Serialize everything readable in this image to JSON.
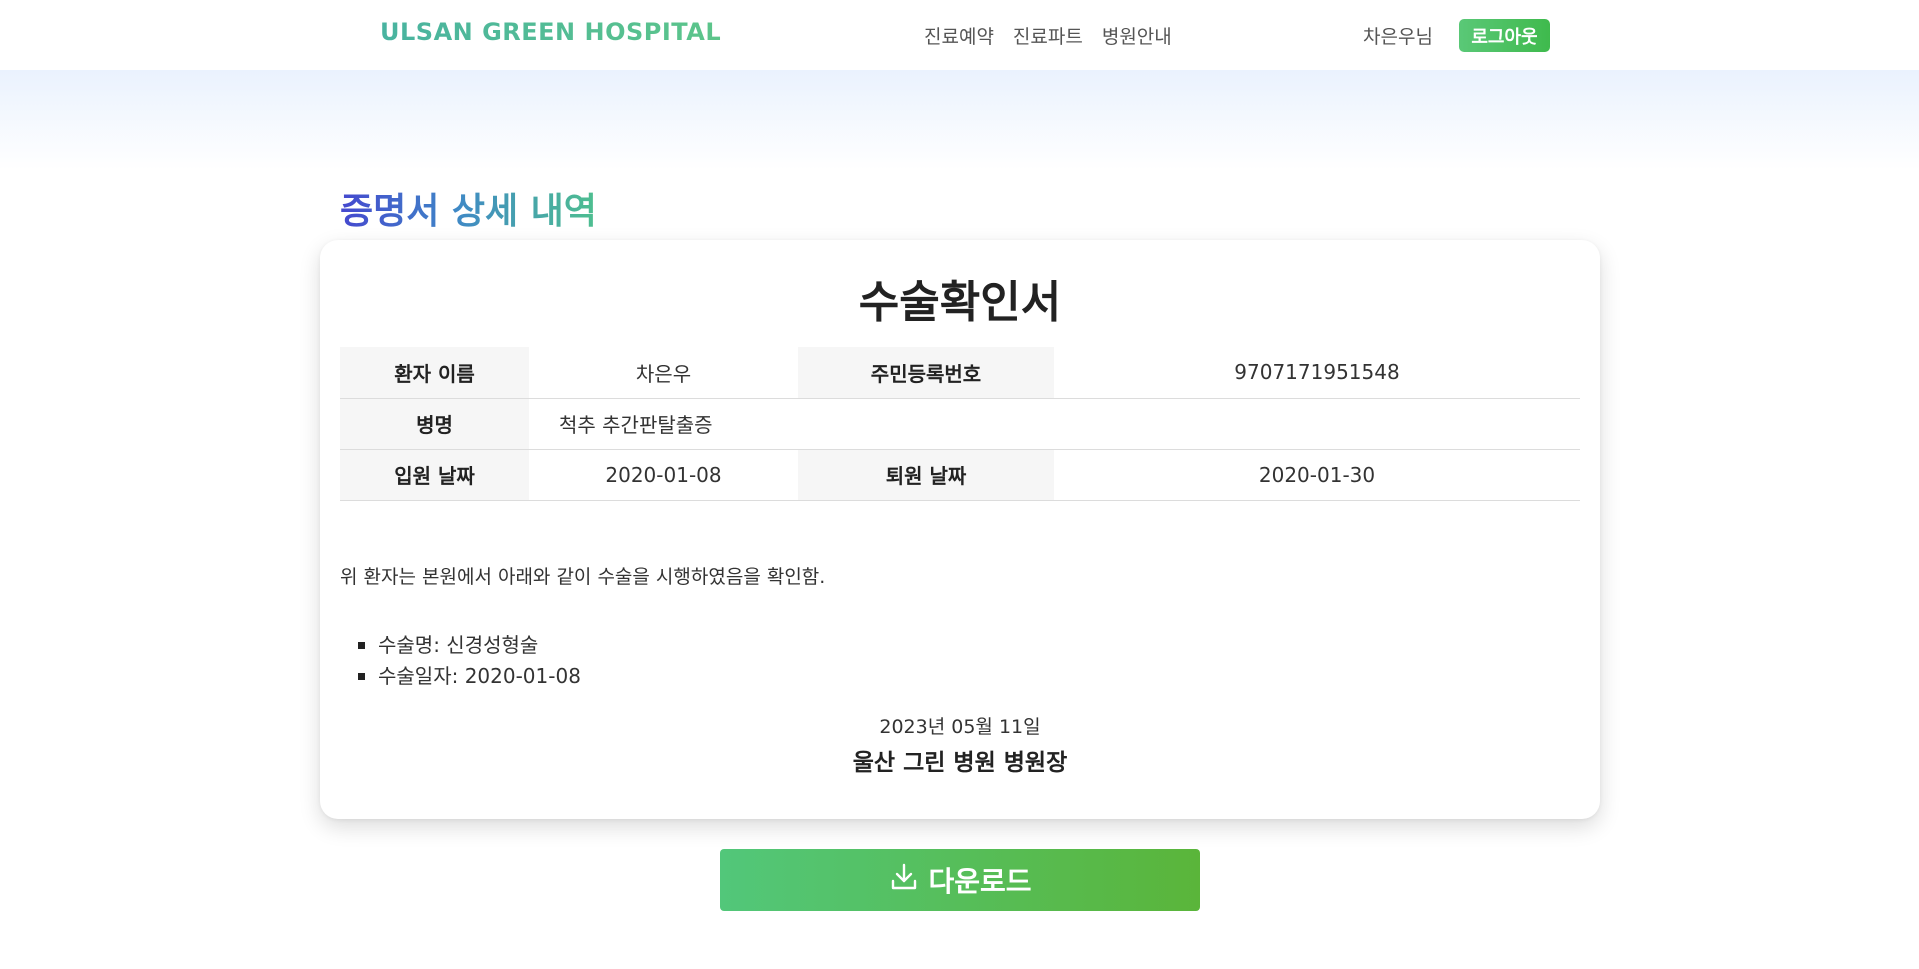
{
  "nav": {
    "brand": "ULSAN GREEN HOSPITAL",
    "links": [
      "진료예약",
      "진료파트",
      "병원안내"
    ],
    "user_name": "차은우님",
    "logout_label": "로그아웃"
  },
  "page": {
    "title": "증명서 상세 내역"
  },
  "document": {
    "title": "수술확인서",
    "rows": {
      "patient_name_label": "환자 이름",
      "patient_name": "차은우",
      "rrn_label": "주민등록번호",
      "rrn": "9707171951548",
      "disease_label": "병명",
      "disease": "척추 추간판탈출증",
      "admission_label": "입원 날짜",
      "admission_date": "2020-01-08",
      "discharge_label": "퇴원 날짜",
      "discharge_date": "2020-01-30"
    },
    "statement": "위 환자는 본원에서 아래와 같이 수술을 시행하였음을 확인함.",
    "surgery_items": [
      "수술명: 신경성형술",
      "수술일자: 2020-01-08"
    ],
    "issue_date": "2023년 05월 11일",
    "issuer": "울산 그린 병원 병원장"
  },
  "actions": {
    "download_label": "다운로드"
  },
  "colors": {
    "brand": "#4fbe96",
    "logout_bg": "#4cc062",
    "download_bg_start": "#52c77a",
    "download_bg_end": "#5ab53a",
    "title_gradient_start": "#4548cf",
    "title_gradient_end": "#4ebf8f"
  },
  "icons": {
    "download": "download-icon"
  }
}
